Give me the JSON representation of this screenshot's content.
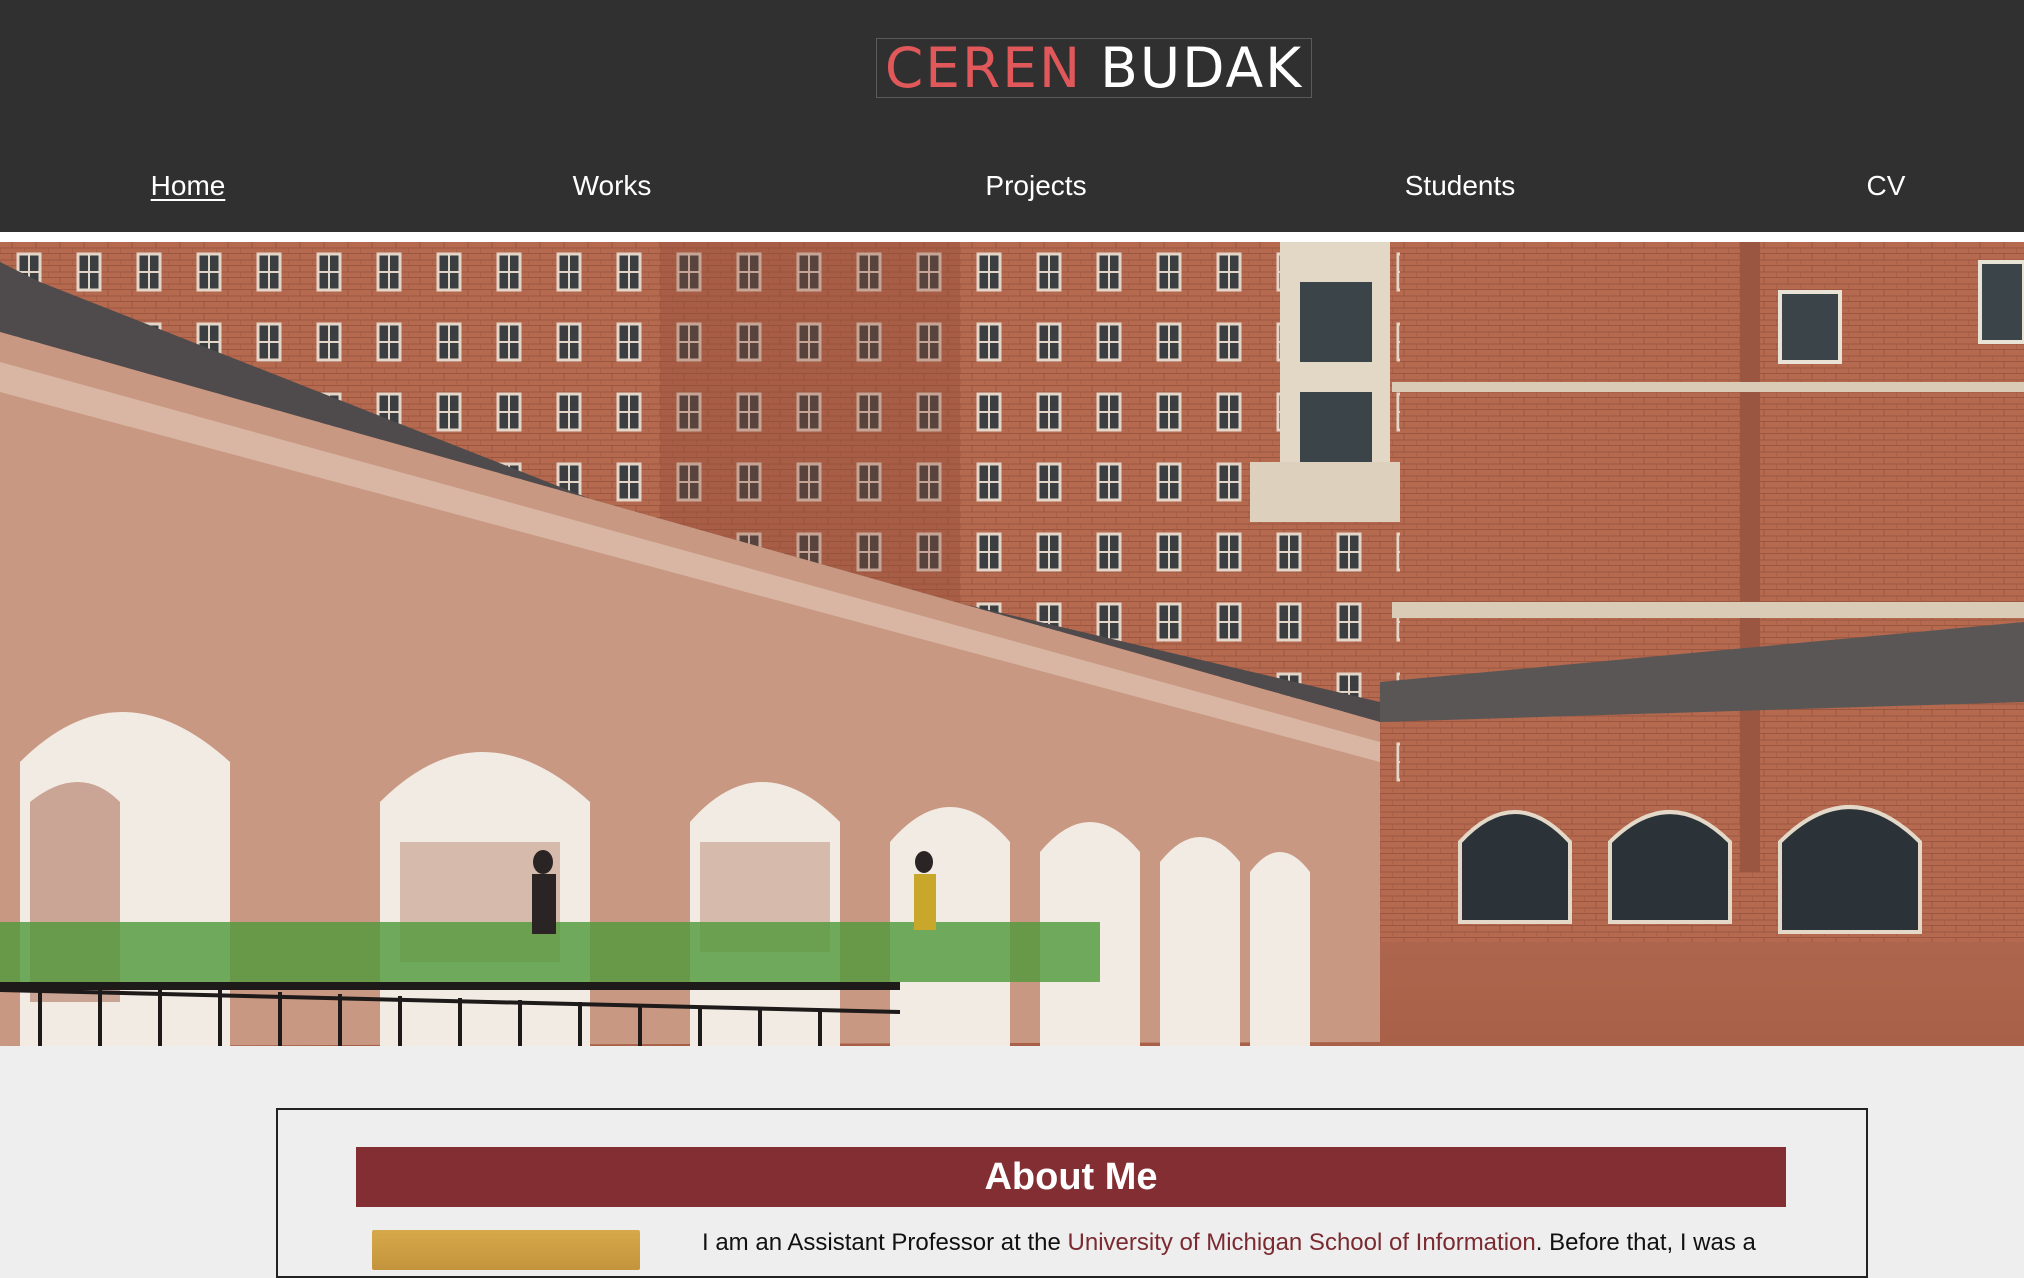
{
  "site": {
    "name_first": "CEREN",
    "name_last": "BUDAK"
  },
  "nav": {
    "items": [
      {
        "label": "Home",
        "active": true
      },
      {
        "label": "Works",
        "active": false
      },
      {
        "label": "Projects",
        "active": false
      },
      {
        "label": "Students",
        "active": false
      },
      {
        "label": "CV",
        "active": false
      }
    ]
  },
  "hero": {
    "icon": "campus-courtyard-photo"
  },
  "about": {
    "heading": "About Me",
    "bio_prefix": "I am an Assistant Professor at the ",
    "bio_link": "University of Michigan School of Information",
    "bio_suffix": ". Before that, I was a"
  },
  "colors": {
    "header_bg": "#303030",
    "logo_accent": "#e0585a",
    "about_bar": "#822e33",
    "link": "#7a2a30",
    "page_bg": "#eeeeee"
  }
}
